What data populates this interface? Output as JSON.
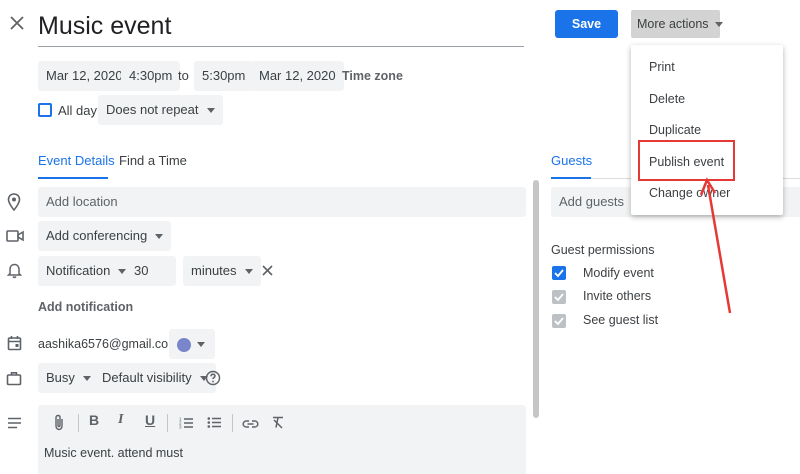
{
  "header": {
    "title": "Music event",
    "save_label": "Save",
    "more_actions_label": "More actions"
  },
  "datetime": {
    "start_date": "Mar 12, 2020",
    "start_time": "4:30pm",
    "to_label": "to",
    "end_time": "5:30pm",
    "end_date": "Mar 12, 2020",
    "timezone_label": "Time zone",
    "all_day_label": "All day",
    "repeat_label": "Does not repeat"
  },
  "tabs": {
    "event_details": "Event Details",
    "find_time": "Find a Time",
    "guests": "Guests"
  },
  "details": {
    "location_placeholder": "Add location",
    "conferencing_label": "Add conferencing",
    "notification_type": "Notification",
    "notification_value": "30",
    "notification_unit": "minutes",
    "add_notification_label": "Add notification",
    "owner_email": "aashika6576@gmail.com",
    "calendar_color": "#7986cb",
    "busy_label": "Busy",
    "visibility_label": "Default visibility",
    "description": "Music event. attend must"
  },
  "guests": {
    "add_placeholder": "Add guests",
    "permissions_title": "Guest permissions",
    "permissions": [
      {
        "label": "Modify event",
        "checked": true,
        "enabled": true
      },
      {
        "label": "Invite others",
        "checked": true,
        "enabled": false
      },
      {
        "label": "See guest list",
        "checked": true,
        "enabled": false
      }
    ]
  },
  "menu": {
    "items": [
      "Print",
      "Delete",
      "Duplicate",
      "Publish event",
      "Change owner"
    ],
    "highlighted_index": 3
  },
  "colors": {
    "accent": "#1a73e8",
    "annotation": "#e53935",
    "chip_bg": "#f1f3f4"
  }
}
